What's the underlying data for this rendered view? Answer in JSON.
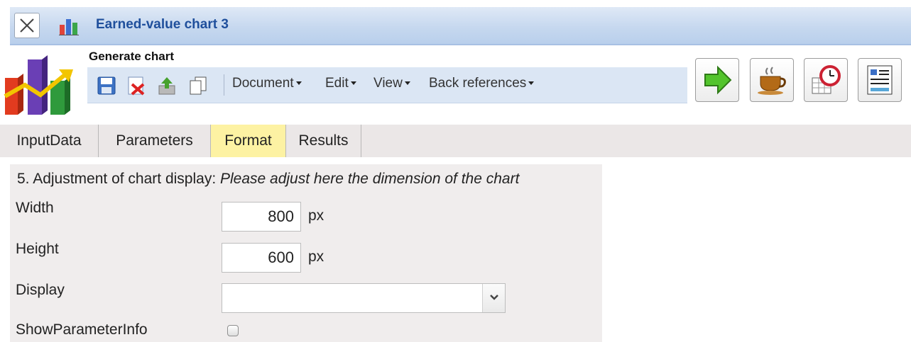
{
  "window": {
    "title": "Earned-value chart 3"
  },
  "header": {
    "section_title": "Generate chart"
  },
  "toolbar": {
    "icons": [
      "save-icon",
      "delete-icon",
      "upload-icon",
      "copy-icon"
    ],
    "menus": [
      {
        "label": "Document"
      },
      {
        "label": "Edit"
      },
      {
        "label": "View"
      },
      {
        "label": "Back references"
      }
    ]
  },
  "actions": [
    "run-arrow-icon",
    "coffee-cup-icon",
    "schedule-clock-icon",
    "report-list-icon"
  ],
  "tabs": [
    {
      "label": "InputData",
      "active": false
    },
    {
      "label": "Parameters",
      "active": false
    },
    {
      "label": "Format",
      "active": true
    },
    {
      "label": "Results",
      "active": false
    }
  ],
  "form": {
    "heading_prefix": "5. Adjustment of chart display: ",
    "heading_hint": "Please adjust here the dimension of the chart",
    "width": {
      "label": "Width",
      "value": "800",
      "unit": "px"
    },
    "height": {
      "label": "Height",
      "value": "600",
      "unit": "px"
    },
    "display": {
      "label": "Display",
      "value": ""
    },
    "show_parameter_info": {
      "label": "ShowParameterInfo",
      "checked": false
    }
  },
  "colors": {
    "title_blue": "#1f4f9c",
    "active_tab": "#fdf2a3",
    "titlebar": "#c6d8ef"
  }
}
